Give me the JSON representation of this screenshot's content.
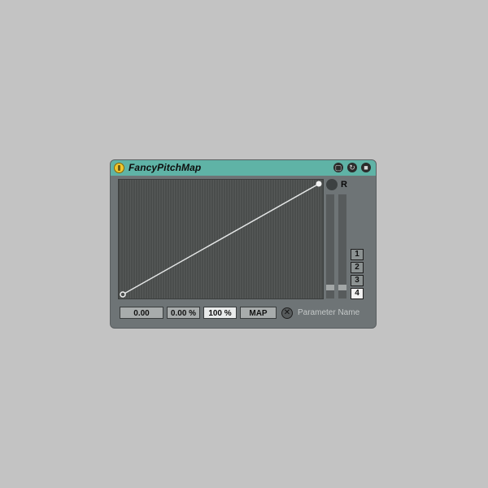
{
  "device": {
    "title": "FancyPitchMap",
    "title_icons": [
      "window-icon",
      "config-icon",
      "save-icon"
    ],
    "r_label": "R",
    "slots": [
      "1",
      "2",
      "3",
      "4"
    ],
    "active_slot": "4",
    "fields": {
      "min_value": "0.00",
      "min_percent": "0.00 %",
      "max_percent": "100 %",
      "map_label": "MAP"
    },
    "clear_symbol": "✕",
    "parameter_name": "Parameter Name",
    "curve": {
      "start": [
        0,
        0
      ],
      "end": [
        1,
        1
      ]
    },
    "sliders": [
      {
        "level": 0.05
      },
      {
        "level": 0.05
      }
    ],
    "colors": {
      "titlebar": "#5fb3a6",
      "power": "#f0c62e",
      "body": "#6e7476",
      "graph_bg": "#4a4d4c"
    }
  }
}
